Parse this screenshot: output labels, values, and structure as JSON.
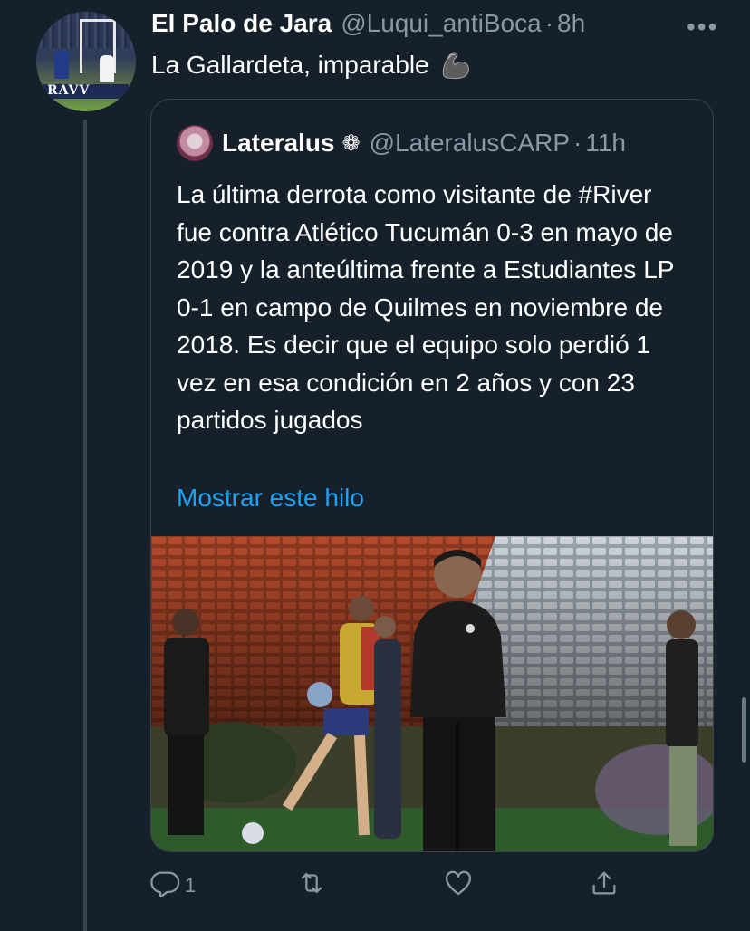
{
  "tweet": {
    "display_name": "El Palo de Jara",
    "handle": "@Luqui_antiBoca",
    "separator": "·",
    "time": "8h",
    "text": "La Gallardeta, imparable",
    "avatar_band_text": "RAVV",
    "more_label": "•••"
  },
  "quoted": {
    "display_name": "Lateralus",
    "badge": "❁",
    "handle": "@LateralusCARP",
    "separator": "·",
    "time": "11h",
    "text": "La última derrota como visitante de #River fue contra Atlético Tucumán 0-3 en mayo de 2019 y la anteúltima frente a Estudiantes LP 0-1 en campo de Quilmes en noviembre de 2018. Es decir que el equipo solo perdió 1 vez en esa condición en 2 años y con 23 partidos jugados",
    "show_thread": "Mostrar este hilo"
  },
  "actions": {
    "reply_count": "1",
    "icons": [
      "reply-icon",
      "retweet-icon",
      "like-icon",
      "share-icon"
    ]
  },
  "colors": {
    "background": "#15202b",
    "border": "#38444d",
    "secondary_text": "#8899a6",
    "link": "#1da1f2"
  }
}
